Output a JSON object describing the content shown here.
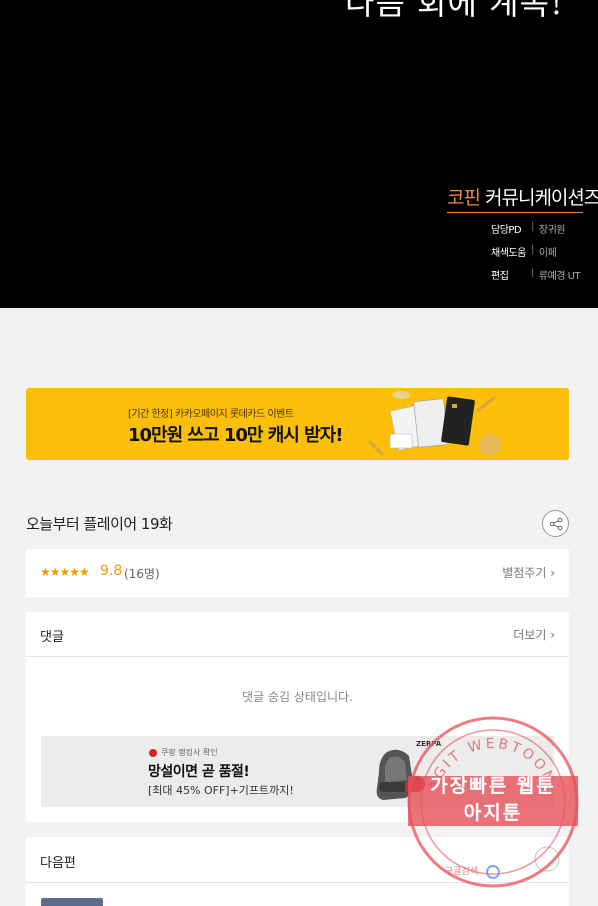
{
  "hero": {
    "cut_title": "다음 회에 계속!",
    "studio_brand": "코핀",
    "studio_rest": " 커뮤니케이션즈",
    "credits": [
      {
        "role": "담당PD",
        "name": "장귀원"
      },
      {
        "role": "채색도움",
        "name": "이페"
      },
      {
        "role": "편집",
        "name": "류예경 UT"
      }
    ]
  },
  "banner": {
    "sub_text": "[기간 한정] 카카오페이지 롯데카드 이벤트",
    "main_text": "10만원 쓰고 10만 캐시 받자!"
  },
  "episode": {
    "title": "오늘부터 플레이어 19화"
  },
  "rating": {
    "stars": "★★★★★",
    "score": "9.8",
    "count": "(16명)",
    "rate_link": "별점주기 ›"
  },
  "comments": {
    "title": "댓글",
    "more_link": "더보기 ›",
    "hidden_message": "댓글 숨김 상태입니다."
  },
  "ad": {
    "tag": "쿠팡 랭킹사 확인",
    "headline": "망설이면 곧 품절!",
    "desc": "[최대 45% OFF]+기프트까지!",
    "brand": "ZERPA"
  },
  "next": {
    "title": "다음편"
  },
  "watermark": {
    "line1": "가장빠른 웹툰",
    "line2": "아지툰",
    "arc_text": "AGIT WEBTOON",
    "bottom_text": "구글검색"
  },
  "colors": {
    "accent": "#f29b00",
    "banner_bg": "#fbbf0a",
    "stamp": "#e8505a"
  }
}
